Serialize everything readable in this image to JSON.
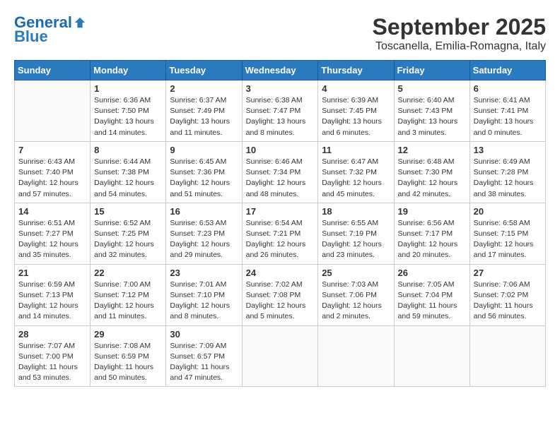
{
  "header": {
    "logo_line1": "General",
    "logo_line2": "Blue",
    "month": "September 2025",
    "location": "Toscanella, Emilia-Romagna, Italy"
  },
  "days_of_week": [
    "Sunday",
    "Monday",
    "Tuesday",
    "Wednesday",
    "Thursday",
    "Friday",
    "Saturday"
  ],
  "weeks": [
    [
      {
        "day": "",
        "info": ""
      },
      {
        "day": "1",
        "info": "Sunrise: 6:36 AM\nSunset: 7:50 PM\nDaylight: 13 hours\nand 14 minutes."
      },
      {
        "day": "2",
        "info": "Sunrise: 6:37 AM\nSunset: 7:49 PM\nDaylight: 13 hours\nand 11 minutes."
      },
      {
        "day": "3",
        "info": "Sunrise: 6:38 AM\nSunset: 7:47 PM\nDaylight: 13 hours\nand 8 minutes."
      },
      {
        "day": "4",
        "info": "Sunrise: 6:39 AM\nSunset: 7:45 PM\nDaylight: 13 hours\nand 6 minutes."
      },
      {
        "day": "5",
        "info": "Sunrise: 6:40 AM\nSunset: 7:43 PM\nDaylight: 13 hours\nand 3 minutes."
      },
      {
        "day": "6",
        "info": "Sunrise: 6:41 AM\nSunset: 7:41 PM\nDaylight: 13 hours\nand 0 minutes."
      }
    ],
    [
      {
        "day": "7",
        "info": "Sunrise: 6:43 AM\nSunset: 7:40 PM\nDaylight: 12 hours\nand 57 minutes."
      },
      {
        "day": "8",
        "info": "Sunrise: 6:44 AM\nSunset: 7:38 PM\nDaylight: 12 hours\nand 54 minutes."
      },
      {
        "day": "9",
        "info": "Sunrise: 6:45 AM\nSunset: 7:36 PM\nDaylight: 12 hours\nand 51 minutes."
      },
      {
        "day": "10",
        "info": "Sunrise: 6:46 AM\nSunset: 7:34 PM\nDaylight: 12 hours\nand 48 minutes."
      },
      {
        "day": "11",
        "info": "Sunrise: 6:47 AM\nSunset: 7:32 PM\nDaylight: 12 hours\nand 45 minutes."
      },
      {
        "day": "12",
        "info": "Sunrise: 6:48 AM\nSunset: 7:30 PM\nDaylight: 12 hours\nand 42 minutes."
      },
      {
        "day": "13",
        "info": "Sunrise: 6:49 AM\nSunset: 7:28 PM\nDaylight: 12 hours\nand 38 minutes."
      }
    ],
    [
      {
        "day": "14",
        "info": "Sunrise: 6:51 AM\nSunset: 7:27 PM\nDaylight: 12 hours\nand 35 minutes."
      },
      {
        "day": "15",
        "info": "Sunrise: 6:52 AM\nSunset: 7:25 PM\nDaylight: 12 hours\nand 32 minutes."
      },
      {
        "day": "16",
        "info": "Sunrise: 6:53 AM\nSunset: 7:23 PM\nDaylight: 12 hours\nand 29 minutes."
      },
      {
        "day": "17",
        "info": "Sunrise: 6:54 AM\nSunset: 7:21 PM\nDaylight: 12 hours\nand 26 minutes."
      },
      {
        "day": "18",
        "info": "Sunrise: 6:55 AM\nSunset: 7:19 PM\nDaylight: 12 hours\nand 23 minutes."
      },
      {
        "day": "19",
        "info": "Sunrise: 6:56 AM\nSunset: 7:17 PM\nDaylight: 12 hours\nand 20 minutes."
      },
      {
        "day": "20",
        "info": "Sunrise: 6:58 AM\nSunset: 7:15 PM\nDaylight: 12 hours\nand 17 minutes."
      }
    ],
    [
      {
        "day": "21",
        "info": "Sunrise: 6:59 AM\nSunset: 7:13 PM\nDaylight: 12 hours\nand 14 minutes."
      },
      {
        "day": "22",
        "info": "Sunrise: 7:00 AM\nSunset: 7:12 PM\nDaylight: 12 hours\nand 11 minutes."
      },
      {
        "day": "23",
        "info": "Sunrise: 7:01 AM\nSunset: 7:10 PM\nDaylight: 12 hours\nand 8 minutes."
      },
      {
        "day": "24",
        "info": "Sunrise: 7:02 AM\nSunset: 7:08 PM\nDaylight: 12 hours\nand 5 minutes."
      },
      {
        "day": "25",
        "info": "Sunrise: 7:03 AM\nSunset: 7:06 PM\nDaylight: 12 hours\nand 2 minutes."
      },
      {
        "day": "26",
        "info": "Sunrise: 7:05 AM\nSunset: 7:04 PM\nDaylight: 11 hours\nand 59 minutes."
      },
      {
        "day": "27",
        "info": "Sunrise: 7:06 AM\nSunset: 7:02 PM\nDaylight: 11 hours\nand 56 minutes."
      }
    ],
    [
      {
        "day": "28",
        "info": "Sunrise: 7:07 AM\nSunset: 7:00 PM\nDaylight: 11 hours\nand 53 minutes."
      },
      {
        "day": "29",
        "info": "Sunrise: 7:08 AM\nSunset: 6:59 PM\nDaylight: 11 hours\nand 50 minutes."
      },
      {
        "day": "30",
        "info": "Sunrise: 7:09 AM\nSunset: 6:57 PM\nDaylight: 11 hours\nand 47 minutes."
      },
      {
        "day": "",
        "info": ""
      },
      {
        "day": "",
        "info": ""
      },
      {
        "day": "",
        "info": ""
      },
      {
        "day": "",
        "info": ""
      }
    ]
  ]
}
